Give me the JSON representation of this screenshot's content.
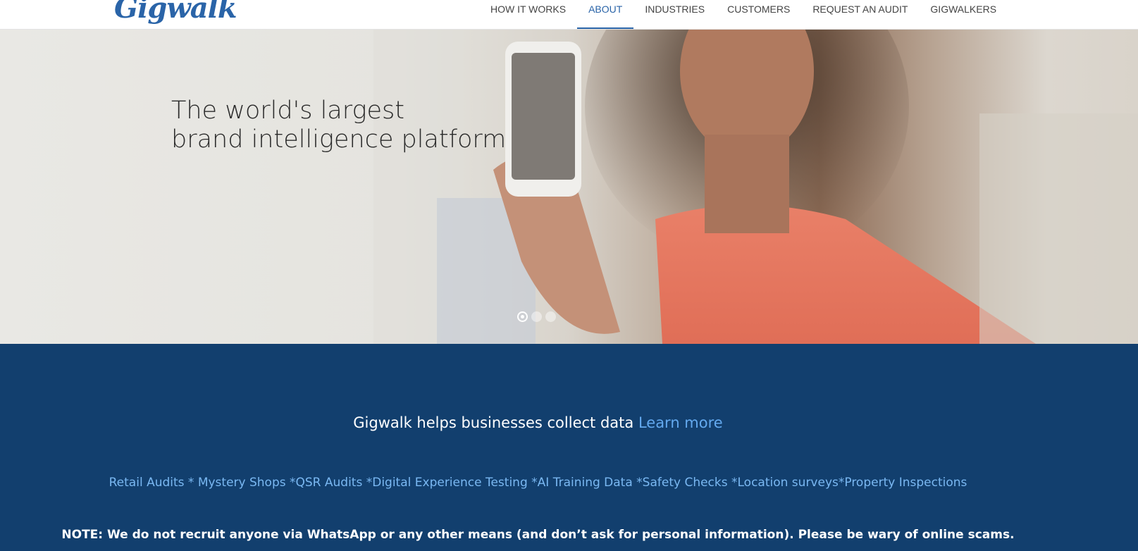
{
  "header": {
    "logo_text": "Gigwalk",
    "nav": [
      {
        "label": "HOW IT WORKS",
        "active": false
      },
      {
        "label": "ABOUT",
        "active": true
      },
      {
        "label": "INDUSTRIES",
        "active": false
      },
      {
        "label": "CUSTOMERS",
        "active": false
      },
      {
        "label": "REQUEST AN AUDIT",
        "active": false
      },
      {
        "label": "GIGWALKERS",
        "active": false
      }
    ],
    "accent_color": "#2a64a8"
  },
  "hero": {
    "title_line1": "The world's largest",
    "title_line2": "brand intelligence platform",
    "image_description_icon": "woman-with-phone-photo",
    "carousel": {
      "slide_count": 3,
      "active_index": 0
    }
  },
  "band": {
    "background_color": "#123f6e",
    "tagline": "Gigwalk helps businesses collect data",
    "learn_more": "Learn more",
    "services": "Retail Audits * Mystery Shops *QSR Audits *Digital Experience Testing *AI Training Data *Safety Checks *Location surveys*Property Inspections",
    "note": "NOTE: We do not recruit anyone via WhatsApp or any other means (and don’t ask for personal information). Please be wary of online scams."
  }
}
